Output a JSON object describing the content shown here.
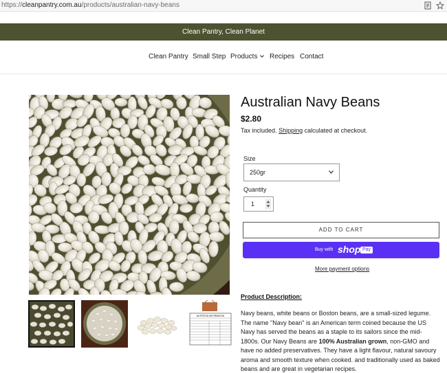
{
  "browser": {
    "url_prefix": "https://",
    "url_domain": "cleanpantry.com.au",
    "url_path": "/products/australian-navy-beans",
    "reader_icon": "reader-view-icon",
    "star_icon": "bookmark-star-icon"
  },
  "announcement": {
    "text": "Clean Pantry, Clean Planet"
  },
  "nav": {
    "items": [
      "Clean Pantry",
      "Small Step",
      "Products",
      "Recipes",
      "Contact"
    ],
    "dropdown_icon": "chevron-down-icon"
  },
  "product": {
    "title": "Australian Navy Beans",
    "price": "$2.80",
    "tax_before": "Tax included.",
    "tax_link": "Shipping",
    "tax_after": "calculated at checkout.",
    "size_label": "Size",
    "size_value": "250gr",
    "quantity_label": "Quantity",
    "quantity_value": "1",
    "add_to_cart": "ADD TO CART",
    "buy_with": "Buy with",
    "shop_brand": "shop",
    "pay_brand": "Pay",
    "more_payment": "More payment options"
  },
  "description": {
    "heading": "Product Description:",
    "p1": "Navy beans, white beans or Boston beans, are a small-sized legume. The name \"Navy bean\" is an American term coined because the US Navy has served the beans as a staple to its sailors since the mid-1800s. Our Navy Beans are ",
    "bold": "100% Australian grown",
    "p2": ", non-GMO and have no added preservatives. They have a light flavour, natural savoury aroma and smooth texture when cooked. and traditionally used as baked beans and are great in vegetarian recipes."
  },
  "thumbnail_label": "NUTRITION INFORMATION",
  "colors": {
    "announcement_bg": "#4d5331",
    "shop_pay": "#5a31f4",
    "bean": "#e9e4da",
    "bowl": "#5a5a3a"
  }
}
